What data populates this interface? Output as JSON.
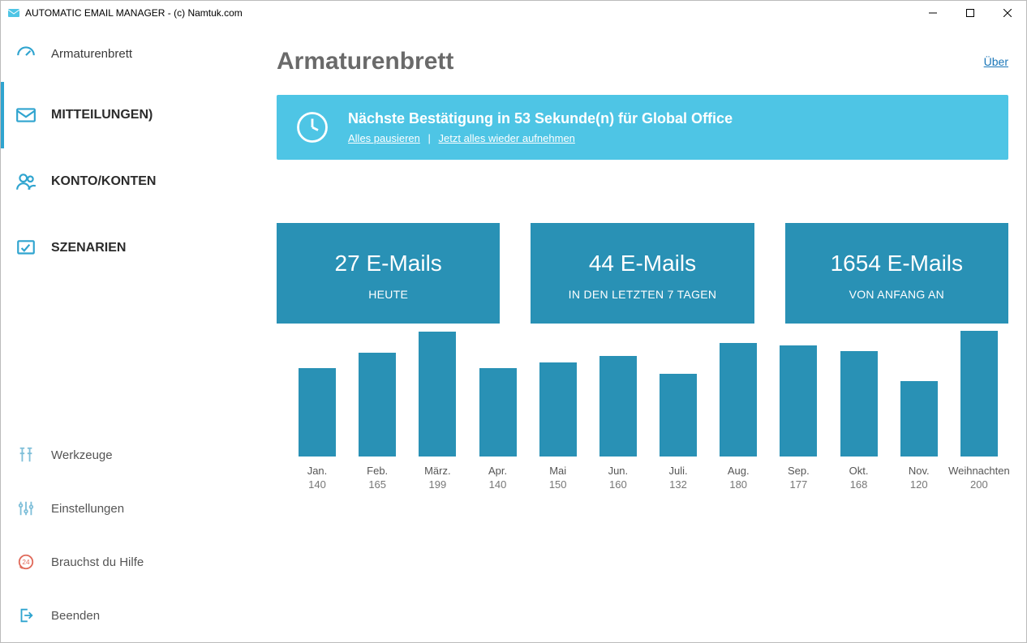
{
  "window": {
    "title": "AUTOMATIC EMAIL MANAGER - (c) Namtuk.com"
  },
  "sidebar": {
    "dashboard": "Armaturenbrett",
    "messages": "MITTEILUNGEN)",
    "accounts": "KONTO/KONTEN",
    "scenarios": "SZENARIEN",
    "tools": "Werkzeuge",
    "settings": "Einstellungen",
    "help": "Brauchst du Hilfe",
    "exit": "Beenden"
  },
  "header": {
    "title": "Armaturenbrett",
    "about": "Über"
  },
  "banner": {
    "title": "Nächste Bestätigung in 53 Sekunde(n) für Global Office",
    "pause_all": "Alles pausieren",
    "resume_all": "Jetzt alles wieder aufnehmen"
  },
  "cards": [
    {
      "big": "27 E-Mails",
      "sub": "HEUTE"
    },
    {
      "big": "44 E-Mails",
      "sub": "IN DEN LETZTEN 7 TAGEN"
    },
    {
      "big": "1654 E-Mails",
      "sub": "VON ANFANG AN"
    }
  ],
  "chart_data": {
    "type": "bar",
    "categories": [
      "Jan.",
      "Feb.",
      "März.",
      "Apr.",
      "Mai",
      "Jun.",
      "Juli.",
      "Aug.",
      "Sep.",
      "Okt.",
      "Nov.",
      "Weihnachten"
    ],
    "values": [
      140,
      165,
      199,
      140,
      150,
      160,
      132,
      180,
      177,
      168,
      120,
      200
    ],
    "ylim": [
      0,
      200
    ]
  },
  "colors": {
    "accent": "#2fa4cf",
    "banner_bg": "#4ec5e5",
    "card_bg": "#2991b5"
  }
}
